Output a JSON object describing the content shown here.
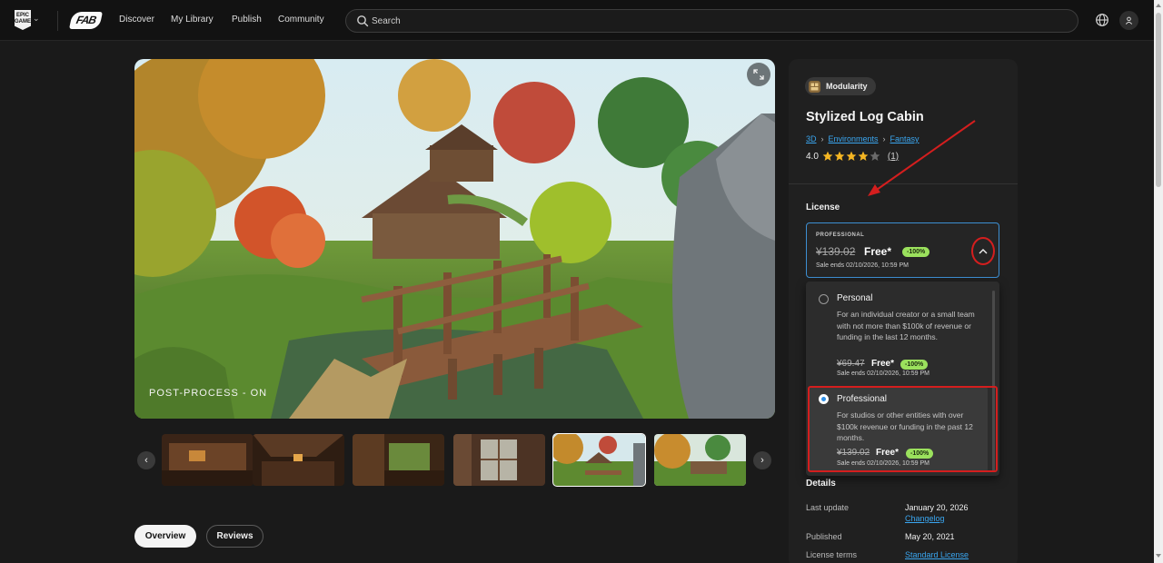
{
  "nav": {
    "logo_text": "EPIC GAMES",
    "brand": "FAB",
    "links": [
      "Discover",
      "My Library",
      "Publish",
      "Community"
    ],
    "search_placeholder": "Search"
  },
  "hero": {
    "caption": "POST-PROCESS - ON",
    "thumbnails_count": 6,
    "active_thumbnail": 5
  },
  "tabs": {
    "overview": "Overview",
    "reviews": "Reviews"
  },
  "product": {
    "category": "Modularity",
    "title": "Stylized Log Cabin",
    "breadcrumbs": [
      "3D",
      "Environments",
      "Fantasy"
    ],
    "rating": "4.0",
    "stars_filled": 4,
    "rating_count": "(1)"
  },
  "license": {
    "heading": "License",
    "selected": {
      "tier": "PROFESSIONAL",
      "old_price": "¥139.02",
      "price": "Free*",
      "discount": "-100%",
      "sale_note": "Sale ends 02/10/2026, 10:59 PM"
    },
    "options": [
      {
        "name": "Personal",
        "description": "For an individual creator or a small team with not more than $100k of revenue or funding in the last 12 months.",
        "old_price": "¥69.47",
        "price": "Free*",
        "discount": "-100%",
        "sale_note": "Sale ends 02/10/2026, 10:59 PM",
        "checked": false
      },
      {
        "name": "Professional",
        "description": "For studios or other entities with over $100k revenue or funding in the past 12 months.",
        "old_price": "¥139.02",
        "price": "Free*",
        "discount": "-100%",
        "sale_note": "Sale ends 02/10/2026, 10:59 PM",
        "checked": true
      }
    ]
  },
  "details": {
    "heading": "Details",
    "last_update_label": "Last update",
    "last_update_value": "January 20, 2026",
    "changelog": "Changelog",
    "published_label": "Published",
    "published_value": "May 20, 2021",
    "license_terms_label": "License terms",
    "license_terms_value": "Standard License"
  },
  "colors": {
    "accent_blue": "#3aa6f0",
    "discount_green": "#9be15d",
    "annotation_red": "#d41e1e",
    "star_gold": "#f5b623"
  }
}
